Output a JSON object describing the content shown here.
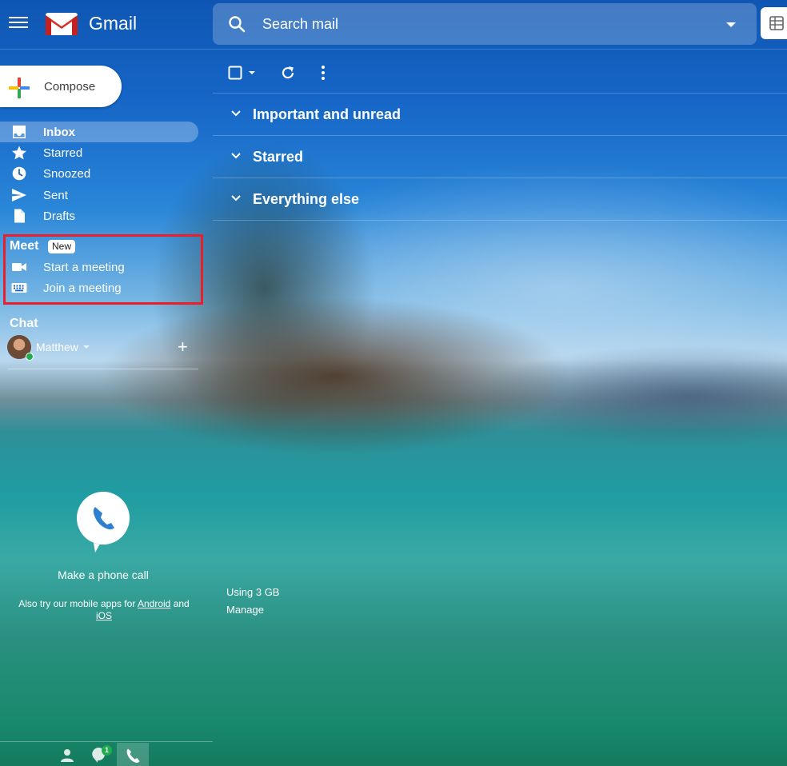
{
  "header": {
    "brand": "Gmail",
    "search_placeholder": "Search mail"
  },
  "compose": {
    "label": "Compose"
  },
  "nav": [
    {
      "label": "Inbox",
      "icon": "inbox-icon",
      "active": true
    },
    {
      "label": "Starred",
      "icon": "star-icon"
    },
    {
      "label": "Snoozed",
      "icon": "clock-icon"
    },
    {
      "label": "Sent",
      "icon": "send-icon"
    },
    {
      "label": "Drafts",
      "icon": "draft-icon"
    }
  ],
  "meet": {
    "title": "Meet",
    "badge": "New",
    "items": [
      {
        "label": "Start a meeting",
        "icon": "video-camera-icon"
      },
      {
        "label": "Join a meeting",
        "icon": "keyboard-icon"
      }
    ],
    "highlight_color": "#e8202a"
  },
  "chat": {
    "title": "Chat",
    "user": "Matthew",
    "presence_color": "#1eae4d"
  },
  "phone": {
    "caption": "Make a phone call",
    "mobile_prefix": "Also try our mobile apps for",
    "android": "Android",
    "and": "and",
    "ios": "iOS"
  },
  "bottom_bar": {
    "chat_badge": "1"
  },
  "main": {
    "sections": [
      {
        "label": "Important and unread"
      },
      {
        "label": "Starred"
      },
      {
        "label": "Everything else"
      }
    ],
    "storage": "Using 3 GB",
    "manage": "Manage"
  }
}
